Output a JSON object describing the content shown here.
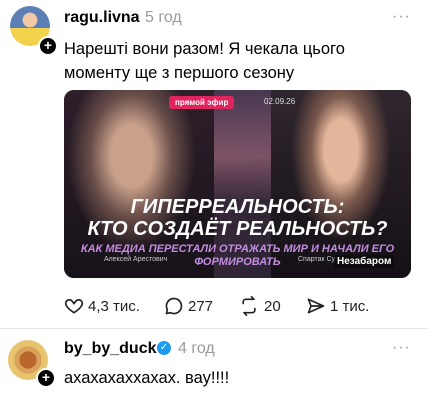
{
  "post1": {
    "username": "ragu.livna",
    "time": "5 год",
    "more": "···",
    "text_line1": "Нарешті вони разом! Я чекала цього",
    "text_line2": "моменту ще з першого сезону",
    "media": {
      "badge": "прямой эфир",
      "date": "02.09.26",
      "title_line1": "ГИПЕРРЕАЛЬНОСТЬ:",
      "title_line2": "КТО СОЗДАЁТ РЕАЛЬНОСТЬ?",
      "subtitle_line1": "КАК МЕДИА ПЕРЕСТАЛИ ОТРАЖАТЬ МИР И НАЧАЛИ ЕГО",
      "subtitle_line2": "ФОРМИРОВАТЬ",
      "guest_left": "Алексей Арестович",
      "guest_right": "Спартак Су",
      "channel": "Незабаром"
    },
    "stats": {
      "likes": "4,3 тис.",
      "replies": "277",
      "reposts": "20",
      "shares": "1 тис."
    }
  },
  "post2": {
    "username": "by_by_duck",
    "time": "4 год",
    "more": "···",
    "text": "ахахахаххахах. вау!!!!"
  },
  "icons": {
    "like": "heart-icon",
    "reply": "comment-icon",
    "repost": "repost-icon",
    "share": "share-icon",
    "verified": "verified-badge-icon",
    "follow": "plus-icon"
  },
  "colors": {
    "accent_badge": "#e0245e",
    "verified": "#1d9bf0",
    "muted": "#9a9a9a"
  }
}
